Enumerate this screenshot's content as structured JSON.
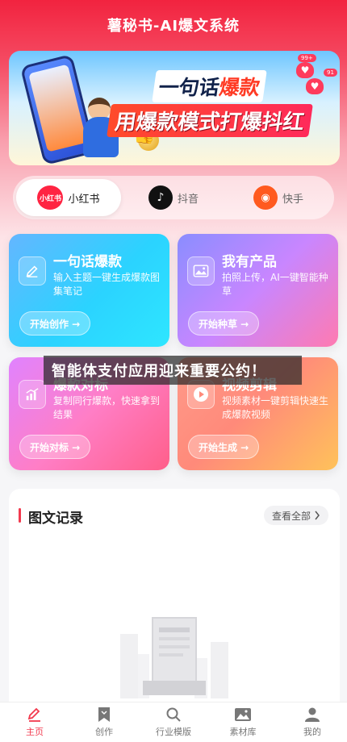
{
  "app": {
    "title": "薯秘书-AI爆文系统"
  },
  "banner": {
    "line1_prefix": "一句话",
    "line1_highlight": "爆款",
    "line2": "用爆款模式打爆抖红",
    "coin_symbol": "¥",
    "bubble1": "99+",
    "bubble2": "91"
  },
  "platforms": [
    {
      "logo": "小红书",
      "label": "小红书",
      "active": true
    },
    {
      "logo": "♪",
      "label": "抖音",
      "active": false
    },
    {
      "logo": "◉",
      "label": "快手",
      "active": false
    }
  ],
  "cards": [
    {
      "title": "一句话爆款",
      "desc": "输入主题一键生成爆款图集笔记",
      "button": "开始创作 →",
      "icon": "pen-icon"
    },
    {
      "title": "我有产品",
      "desc": "拍照上传，AI一键智能种草",
      "button": "开始种草 →",
      "icon": "image-icon"
    },
    {
      "title": "爆款对标",
      "desc": "复制同行爆款，快速拿到结果",
      "button": "开始对标 →",
      "icon": "chart-icon"
    },
    {
      "title": "视频剪辑",
      "desc": "视频素材一键剪辑快速生成爆款视频",
      "button": "开始生成 →",
      "icon": "play-icon"
    }
  ],
  "overlay": {
    "text": "智能体支付应用迎来重要公约！"
  },
  "records": {
    "title": "图文记录",
    "more": "查看全部"
  },
  "nav": [
    {
      "label": "主页",
      "icon": "pen-icon",
      "active": true
    },
    {
      "label": "创作",
      "icon": "bookmark-icon",
      "active": false
    },
    {
      "label": "行业模版",
      "icon": "search-icon",
      "active": false
    },
    {
      "label": "素材库",
      "icon": "image-icon",
      "active": false
    },
    {
      "label": "我的",
      "icon": "user-icon",
      "active": false
    }
  ],
  "colors": {
    "accent": "#f23a4e",
    "brand": "#f2233f"
  }
}
